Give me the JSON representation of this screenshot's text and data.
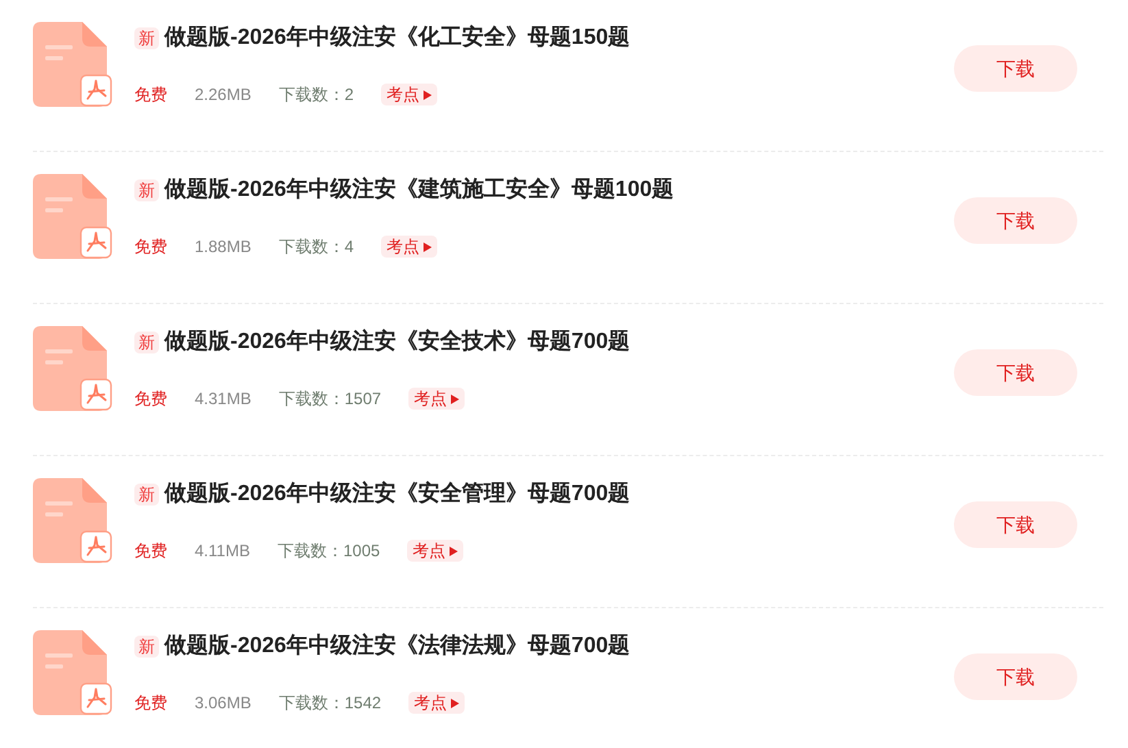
{
  "files": [
    {
      "badge": "新",
      "title": "做题版-2026年中级注安《化工安全》母题150题",
      "price": "免费",
      "size": "2.26MB",
      "downloads": "下载数：2",
      "tag": "考点",
      "button": "下载"
    },
    {
      "badge": "新",
      "title": "做题版-2026年中级注安《建筑施工安全》母题100题",
      "price": "免费",
      "size": "1.88MB",
      "downloads": "下载数：4",
      "tag": "考点",
      "button": "下载"
    },
    {
      "badge": "新",
      "title": "做题版-2026年中级注安《安全技术》母题700题",
      "price": "免费",
      "size": "4.31MB",
      "downloads": "下载数：1507",
      "tag": "考点",
      "button": "下载"
    },
    {
      "badge": "新",
      "title": "做题版-2026年中级注安《安全管理》母题700题",
      "price": "免费",
      "size": "4.11MB",
      "downloads": "下载数：1005",
      "tag": "考点",
      "button": "下载"
    },
    {
      "badge": "新",
      "title": "做题版-2026年中级注安《法律法规》母题700题",
      "price": "免费",
      "size": "3.06MB",
      "downloads": "下载数：1542",
      "tag": "考点",
      "button": "下载"
    }
  ]
}
